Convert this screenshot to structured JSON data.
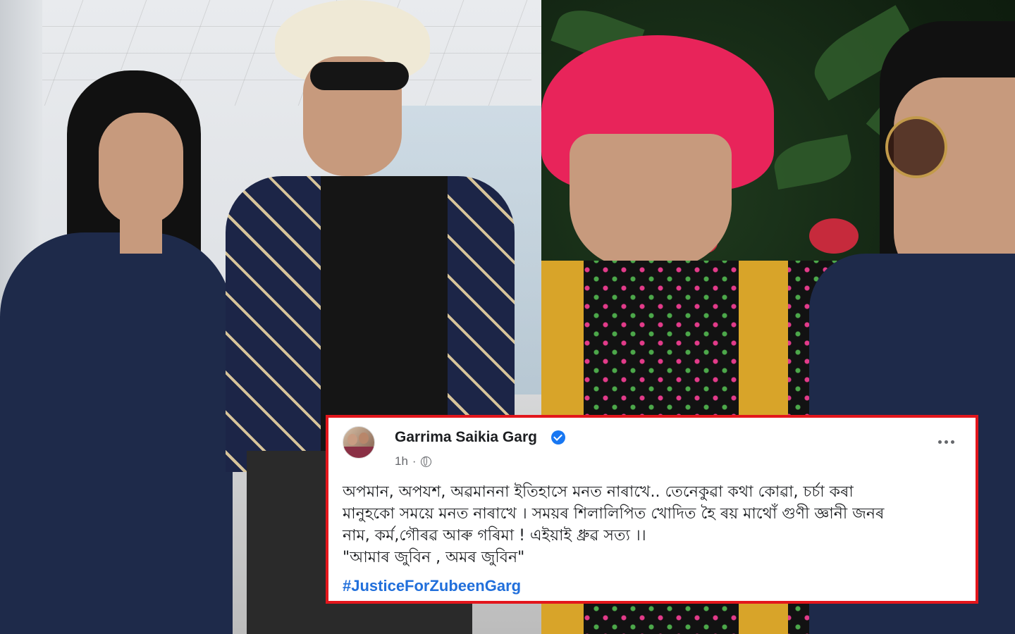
{
  "post": {
    "author": "Garrima Saikia Garg",
    "time": "1h",
    "body_lines": [
      "অপমান, অপযশ, অৱমাননা ইতিহাসে মনত নাৰাখে.. তেনেকুৱা  কথা কোৱা, চৰ্চা কৰা",
      "মানুহকো সময়ে মনত নাৰাখে । সময়ৰ শিলালিপিত খোদিত হৈ ৰয় মাথোঁ গুণী জ্ঞানী জনৰ",
      "নাম, কৰ্ম,গৌৰৱ আৰু গৰিমা ! এইয়াই ধ্রুৱ সত্য ।।",
      "\"আমাৰ জুবিন , অমৰ জুবিন\""
    ],
    "hashtag": "#JusticeForZubeenGarg"
  },
  "colors": {
    "card_border": "#e3161c",
    "hashtag": "#216fdb",
    "verified": "#1877f2"
  },
  "icons": {
    "verified": "verified-badge-icon",
    "privacy": "globe-icon",
    "menu": "more-options-icon"
  }
}
